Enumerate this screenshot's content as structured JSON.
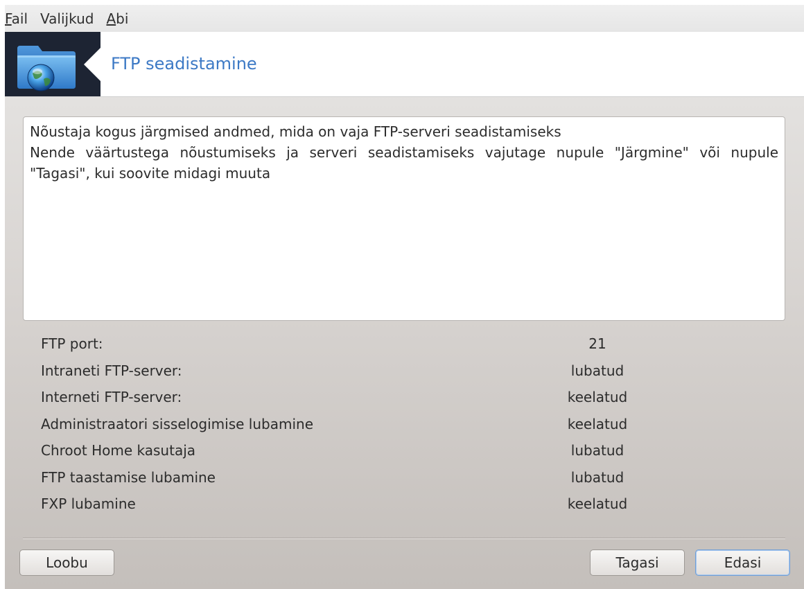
{
  "menubar": {
    "items": [
      {
        "mnemonic": "F",
        "rest": "ail"
      },
      {
        "pre": "Vali",
        "mnemonic": "j",
        "rest": "kud"
      },
      {
        "mnemonic": "A",
        "rest": "bi"
      }
    ]
  },
  "header": {
    "title": "FTP seadistamine",
    "icon": "folder-globe-icon"
  },
  "info": {
    "line1": "Nõustaja kogus järgmised andmed, mida on vaja FTP-serveri seadistamiseks",
    "line2": "Nende väärtustega nõustumiseks ja serveri seadistamiseks vajutage nupule \"Järgmine\" või nupule \"Tagasi\", kui soovite midagi muuta"
  },
  "summary": [
    {
      "label": "FTP port:",
      "value": "21"
    },
    {
      "label": "Intraneti FTP-server:",
      "value": "lubatud"
    },
    {
      "label": "Interneti FTP-server:",
      "value": "keelatud"
    },
    {
      "label": "Administraatori sisselogimise lubamine",
      "value": "keelatud"
    },
    {
      "label": "Chroot Home kasutaja",
      "value": "lubatud"
    },
    {
      "label": "FTP taastamise lubamine",
      "value": "lubatud"
    },
    {
      "label": "FXP lubamine",
      "value": "keelatud"
    }
  ],
  "buttons": {
    "cancel": "Loobu",
    "back": "Tagasi",
    "next": "Edasi"
  },
  "colors": {
    "title": "#3c79c5",
    "header_icon_bg": "#1d2433",
    "focus_border": "#6f9fd8"
  }
}
